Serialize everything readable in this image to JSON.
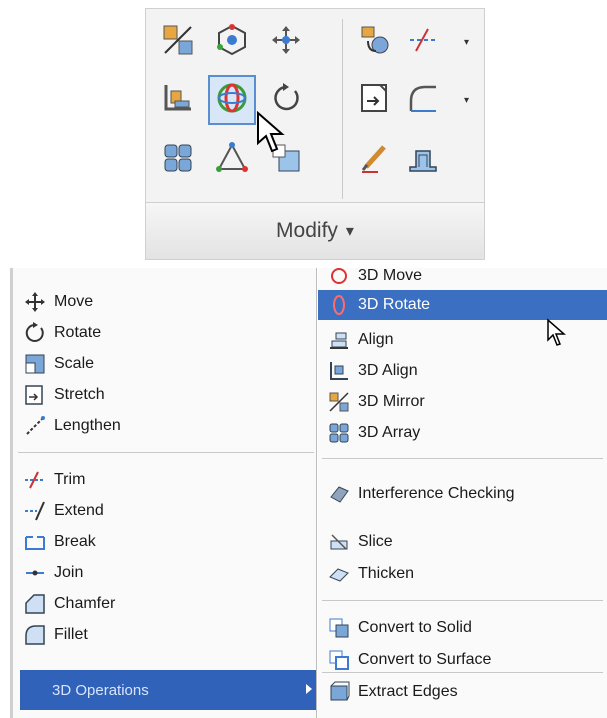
{
  "ribbon": {
    "panel_label": "Modify",
    "dropdown_glyph": "▾",
    "buttons": [
      {
        "name": "3d-mirror-icon"
      },
      {
        "name": "3d-orbit-icon"
      },
      {
        "name": "move-gizmo-icon"
      },
      {
        "name": "copy-rotate-icon"
      },
      {
        "name": "trim-icon"
      },
      {
        "name": "3d-align-icon"
      },
      {
        "name": "3d-rotate-icon"
      },
      {
        "name": "rotate-icon"
      },
      {
        "name": "stretch-icon"
      },
      {
        "name": "fillet-icon"
      },
      {
        "name": "3d-array-icon"
      },
      {
        "name": "3d-scale-icon"
      },
      {
        "name": "scale-gizmo-icon"
      },
      {
        "name": "edit-icon"
      },
      {
        "name": "thicken-icon"
      }
    ]
  },
  "menu": {
    "left": [
      {
        "label": "Move",
        "icon": "move-icon"
      },
      {
        "label": "Rotate",
        "icon": "rotate-icon"
      },
      {
        "label": "Scale",
        "icon": "scale-icon"
      },
      {
        "label": "Stretch",
        "icon": "stretch-icon"
      },
      {
        "label": "Lengthen",
        "icon": "lengthen-icon"
      },
      {
        "label": "Trim",
        "icon": "trim-icon"
      },
      {
        "label": "Extend",
        "icon": "extend-icon"
      },
      {
        "label": "Break",
        "icon": "break-icon"
      },
      {
        "label": "Join",
        "icon": "join-icon"
      },
      {
        "label": "Chamfer",
        "icon": "chamfer-icon"
      },
      {
        "label": "Fillet",
        "icon": "fillet-icon"
      },
      {
        "label": "3D Operations",
        "icon": ""
      }
    ],
    "right": [
      {
        "label": "3D Move",
        "icon": "3d-move-icon"
      },
      {
        "label": "3D Rotate",
        "icon": "3d-rotate-icon"
      },
      {
        "label": "Align",
        "icon": "align-icon"
      },
      {
        "label": "3D Align",
        "icon": "3d-align-icon"
      },
      {
        "label": "3D Mirror",
        "icon": "3d-mirror-icon"
      },
      {
        "label": "3D Array",
        "icon": "3d-array-icon"
      },
      {
        "label": "Interference Checking",
        "icon": "interference-icon"
      },
      {
        "label": "Slice",
        "icon": "slice-icon"
      },
      {
        "label": "Thicken",
        "icon": "thicken-icon"
      },
      {
        "label": "Convert to Solid",
        "icon": "convert-solid-icon"
      },
      {
        "label": "Convert to Surface",
        "icon": "convert-surface-icon"
      },
      {
        "label": "Extract Edges",
        "icon": "extract-edges-icon"
      }
    ]
  },
  "colors": {
    "highlight": "#3a6fc1",
    "selected_border": "#5a8ed0"
  }
}
